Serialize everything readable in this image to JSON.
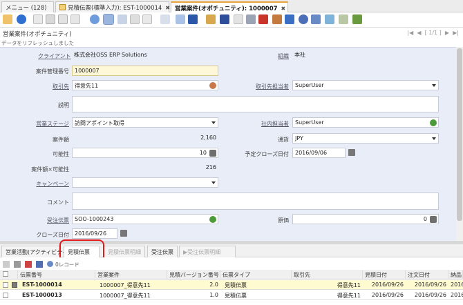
{
  "window_tabs": [
    {
      "label": "メニュー (128)",
      "active": false
    },
    {
      "label": "見積伝票(標準入力): EST-1000014",
      "active": false,
      "close": "✖"
    },
    {
      "label": "営業案件(オポチュニティ): 1000007",
      "active": true,
      "close": "✖"
    }
  ],
  "header": {
    "title": "営業案件(オポチュニティ)",
    "nav_text": "[ 1/1 ]",
    "status_message": "データをリフレッシュしました"
  },
  "fields": {
    "client": {
      "label": "クライアント",
      "value": "株式会社OSS ERP Solutions"
    },
    "org": {
      "label": "組織",
      "value": "本社"
    },
    "case_no": {
      "label": "案件管理番号",
      "value": "1000007"
    },
    "bpartner": {
      "label": "取引先",
      "value": "得意先11"
    },
    "bp_contact": {
      "label": "取引先担当者",
      "value": "SuperUser"
    },
    "description": {
      "label": "説明",
      "value": ""
    },
    "sales_stage": {
      "label": "営業ステージ",
      "value": "訪問アポイント取得"
    },
    "sales_rep": {
      "label": "社内担当者",
      "value": "SuperUser"
    },
    "amount": {
      "label": "案件額",
      "value": "2,160"
    },
    "currency": {
      "label": "通貨",
      "value": "JPY"
    },
    "probability": {
      "label": "可能性",
      "value": "10"
    },
    "close_date_expected": {
      "label": "予定クローズ日付",
      "value": "2016/09/06"
    },
    "weighted": {
      "label": "案件額×可能性",
      "value": "216"
    },
    "campaign": {
      "label": "キャンペーン",
      "value": ""
    },
    "comments": {
      "label": "コメント",
      "value": ""
    },
    "order": {
      "label": "受注伝票",
      "value": "SOO-1000243"
    },
    "cost": {
      "label": "原価",
      "value": "0"
    },
    "close_date": {
      "label": "クローズ日付",
      "value": "2016/09/26"
    }
  },
  "detail_tabs": [
    {
      "label": "営業活動(アクティビティ)",
      "state": "normal"
    },
    {
      "label": "見積伝票",
      "state": "selected"
    },
    {
      "label": "見積伝票明細",
      "state": "disabled"
    },
    {
      "label": "受注伝票",
      "state": "normal"
    },
    {
      "label": "▶受注伝票明細",
      "state": "disabled"
    }
  ],
  "grid_toolbar": {
    "record_label": "0レコード"
  },
  "grid": {
    "columns": [
      "伝票番号",
      "営業案件",
      "見積バージョン番号",
      "伝票タイプ",
      "取引先",
      "見積日付",
      "注文日付",
      "納品"
    ],
    "rows": [
      [
        "EST-1000014",
        "1000007_得意先11",
        "2.0",
        "見積伝票",
        "得意先11",
        "2016/09/26",
        "2016/09/26",
        "2016"
      ],
      [
        "EST-1000013",
        "1000007_得意先11",
        "1.0",
        "見積伝票",
        "得意先11",
        "2016/09/26",
        "2016/09/26",
        "2016"
      ]
    ]
  },
  "colors": {
    "accent_tab": "#e8a23b",
    "form_bg": "#e8edf7",
    "required_bg": "#fff8d8",
    "highlight_red": "#e0191b",
    "selected_row": "#fffbd0"
  }
}
